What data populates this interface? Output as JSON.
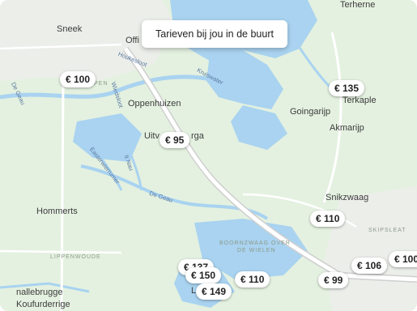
{
  "banner": {
    "label": "Tarieven bij jou in de buurt"
  },
  "places": {
    "sneek": "Sneek",
    "offingawier": "Offi",
    "terherne": "Terherne",
    "oppenhuizen": "Oppenhuizen",
    "uitwellingerga_a": "Uitv",
    "uitwellingerga_b": "rga",
    "goingarijp": "Goingarijp",
    "terkaple": "Terkaple",
    "akmarijp": "Akmarijp",
    "hommerts": "Hommerts",
    "snikzwaag": "Snikzwaag",
    "skipsleat": "SKIPSLEAT",
    "lippenwoude": "LIPPENWOUDE",
    "boornzwaag": "BOORNZWAAG OVER",
    "boornzwaag2": "DE WIELEN",
    "heeg_bridge": "nallebrugge",
    "koufurderrige": "Koufurderrige",
    "road_houkesloot": "Houkesloot",
    "road_krutsweter": "Kruiswater",
    "road_de_geau": "De Geau",
    "road_it_nau": "It Nau",
    "road_easterwierrum": "Easterwierrumer",
    "road_wiedsloot": "Wiedsloot",
    "road_de_geau_left": "De Geau",
    "road_pen": "PEN",
    "lake_l": "L"
  },
  "pins": [
    {
      "label": "€ 100"
    },
    {
      "label": "€ 135"
    },
    {
      "label": "€ 95"
    },
    {
      "label": "€ 110"
    },
    {
      "label": "€ 106"
    },
    {
      "label": "€ 100"
    },
    {
      "label": "€ 99"
    },
    {
      "label": "€ 110"
    },
    {
      "label": "€ 137"
    },
    {
      "label": "€ 150"
    },
    {
      "label": "€ 149"
    }
  ],
  "colors": {
    "land": "#e4f1e0",
    "water": "#a9d3f0",
    "road": "#ffffff",
    "road_outline": "#c9c9c9",
    "urban": "#eef0ee"
  }
}
